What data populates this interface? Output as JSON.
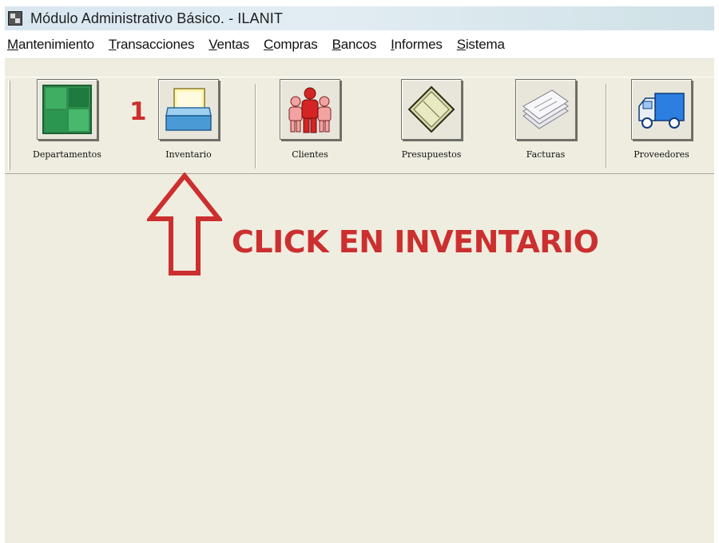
{
  "window": {
    "title": "Módulo Administrativo Básico. - ILANIT",
    "app_icon": "app-logo-icon"
  },
  "menu": {
    "items": [
      {
        "label": "Mantenimiento",
        "mnemonic": "M"
      },
      {
        "label": "Transacciones",
        "mnemonic": "T"
      },
      {
        "label": "Ventas",
        "mnemonic": "V"
      },
      {
        "label": "Compras",
        "mnemonic": "C"
      },
      {
        "label": "Bancos",
        "mnemonic": "B"
      },
      {
        "label": "Informes",
        "mnemonic": "I"
      },
      {
        "label": "Sistema",
        "mnemonic": "S"
      }
    ]
  },
  "toolbar": {
    "buttons": [
      {
        "label": "Departamentos",
        "icon": "departments-grid-icon"
      },
      {
        "label": "Inventario",
        "icon": "inventory-box-icon"
      },
      {
        "label": "Clientes",
        "icon": "clients-people-icon"
      },
      {
        "label": "Presupuestos",
        "icon": "budget-book-icon"
      },
      {
        "label": "Facturas",
        "icon": "invoices-papers-icon"
      },
      {
        "label": "Proveedores",
        "icon": "supplier-truck-icon"
      }
    ]
  },
  "annotation": {
    "step_number": "1",
    "instruction": "CLICK EN INVENTARIO",
    "color": "#cc2f2f"
  }
}
